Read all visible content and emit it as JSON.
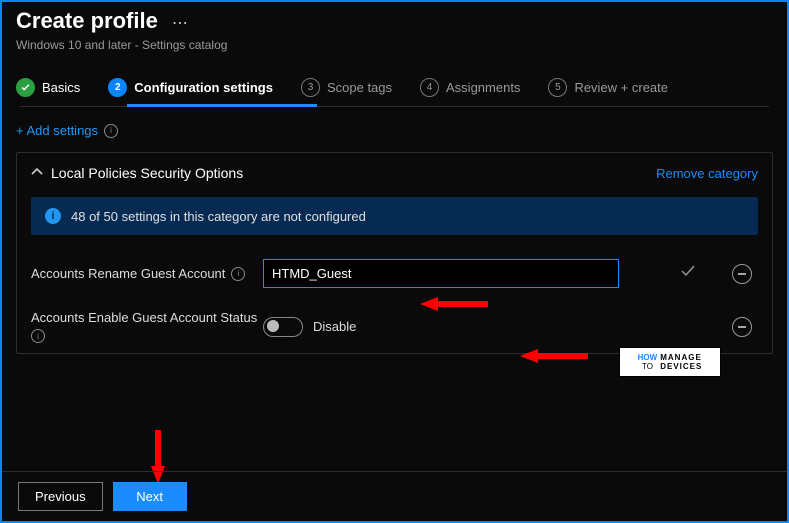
{
  "header": {
    "title": "Create profile",
    "subtitle": "Windows 10 and later - Settings catalog"
  },
  "steps": {
    "basics": "Basics",
    "config": "Configuration settings",
    "scope": "Scope tags",
    "assign": "Assignments",
    "review": "Review + create",
    "num2": "2",
    "num3": "3",
    "num4": "4",
    "num5": "5"
  },
  "addSettings": "+ Add settings",
  "panel": {
    "title": "Local Policies Security Options",
    "remove": "Remove category",
    "banner": "48 of 50 settings in this category are not configured"
  },
  "settings": {
    "rename": {
      "label": "Accounts Rename Guest Account",
      "value": "HTMD_Guest"
    },
    "enable": {
      "label": "Accounts Enable Guest Account Status",
      "state": "Disable"
    }
  },
  "buttons": {
    "prev": "Previous",
    "next": "Next"
  },
  "watermark": {
    "l1": "HOW",
    "l2": "TO",
    "r1": "MANAGE",
    "r2": "DEVICES"
  }
}
